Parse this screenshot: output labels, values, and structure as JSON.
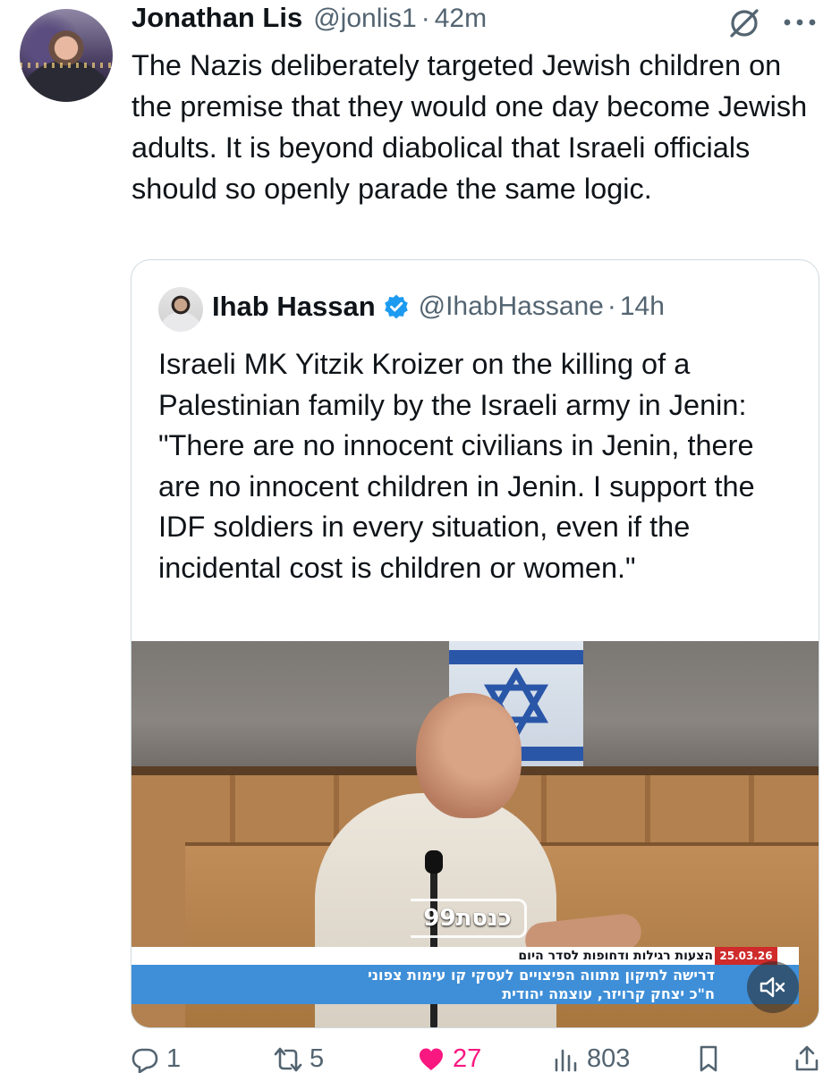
{
  "tweet": {
    "author": {
      "display_name": "Jonathan Lis",
      "handle": "@jonlis1",
      "separator": "·",
      "time": "42m"
    },
    "text": "The Nazis deliberately targeted Jewish children on the premise that they would one day become Jewish adults. It is beyond diabolical that Israeli officials should so openly parade the same logic.",
    "icons": {
      "grok": "grok-icon",
      "more": "more-icon"
    }
  },
  "quoted_tweet": {
    "author": {
      "display_name": "Ihab Hassan",
      "verified": true,
      "handle": "@IhabHassane",
      "separator": "·",
      "time": "14h"
    },
    "text": "Israeli MK Yitzik Kroizer on the killing of a Palestinian family by the Israeli army in Jenin: \"There are no innocent civilians in Jenin, there are no innocent children in Jenin. I support the IDF soldiers in every situation, even if the incidental cost is children or women.\"",
    "video": {
      "channel_logo": "כנסת99",
      "ticker_top": "הצעות רגילות ודחופות לסדר היום",
      "date_badge": "25.03.26",
      "ticker_line1": "דרישה לתיקון מתווה הפיצויים לעסקי קו עימות צפוני",
      "ticker_line2": "ח\"כ יצחק קרויזר, עוצמה יהודית",
      "muted": true
    }
  },
  "actions": {
    "replies": "1",
    "reposts": "5",
    "likes": "27",
    "views": "803",
    "accent_like_color": "#f91880",
    "icon_color": "#536471"
  }
}
